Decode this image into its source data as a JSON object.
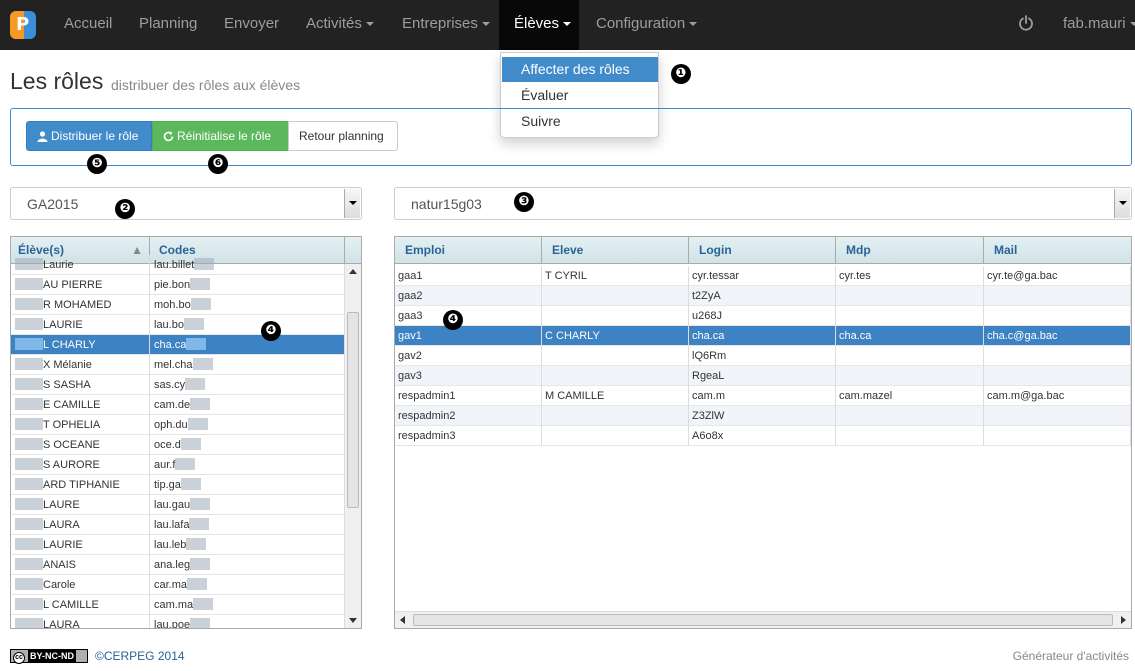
{
  "nav": {
    "items": [
      "Accueil",
      "Planning",
      "Envoyer",
      "Activités",
      "Entreprises",
      "Élèves",
      "Configuration"
    ],
    "user": "fab.mauri"
  },
  "dropdown": {
    "items": [
      "Affecter des rôles",
      "Évaluer",
      "Suivre"
    ]
  },
  "markers": [
    "❶",
    "❷",
    "❸",
    "❹",
    "❹",
    "❺",
    "❻"
  ],
  "header": {
    "title": "Les rôles",
    "subtitle": "distribuer des rôles aux élèves"
  },
  "toolbar": {
    "distribute": "Distribuer le rôle",
    "reset": "Réinitialise le rôle",
    "back": "Retour planning"
  },
  "selects": {
    "group": "GA2015",
    "activity": "natur15g03"
  },
  "students": {
    "headers": [
      "Élève(s)",
      "Codes"
    ],
    "rows": [
      [
        "Laurie",
        "lau.billet"
      ],
      [
        "AU PIERRE",
        "pie.bon"
      ],
      [
        "R MOHAMED",
        "moh.bo"
      ],
      [
        "LAURIE",
        "lau.bo"
      ],
      [
        "L CHARLY",
        "cha.ca"
      ],
      [
        "X Mélanie",
        "mel.cha"
      ],
      [
        "S SASHA",
        "sas.cy"
      ],
      [
        "E CAMILLE",
        "cam.de"
      ],
      [
        "T OPHELIA",
        "oph.du"
      ],
      [
        "S OCEANE",
        "oce.d"
      ],
      [
        "S AURORE",
        "aur.f"
      ],
      [
        "ARD TIPHANIE",
        "tip.ga"
      ],
      [
        "LAURE",
        "lau.gau"
      ],
      [
        "LAURA",
        "lau.lafa"
      ],
      [
        "LAURIE",
        "lau.leb"
      ],
      [
        "ANAIS",
        "ana.leg"
      ],
      [
        "Carole",
        "car.ma"
      ],
      [
        "L CAMILLE",
        "cam.ma"
      ],
      [
        "LAURA",
        "lau.poe"
      ]
    ]
  },
  "roles": {
    "headers": [
      "Emploi",
      "Eleve",
      "Login",
      "Mdp",
      "Mail"
    ],
    "rows": [
      [
        "gaa1",
        "T CYRIL",
        "cyr.tessar",
        "cyr.tes",
        "cyr.te@ga.bac"
      ],
      [
        "gaa2",
        "",
        "t2ZyA",
        "",
        ""
      ],
      [
        "gaa3",
        "",
        "u268J",
        "",
        ""
      ],
      [
        "gav1",
        "C CHARLY",
        "cha.ca",
        "cha.ca",
        "cha.c@ga.bac"
      ],
      [
        "gav2",
        "",
        "lQ6Rm",
        "",
        ""
      ],
      [
        "gav3",
        "",
        "RgeaL",
        "",
        ""
      ],
      [
        "respadmin1",
        "M CAMILLE",
        "cam.m",
        "cam.mazel",
        "cam.m@ga.bac"
      ],
      [
        "respadmin2",
        "",
        "Z3ZlW",
        "",
        ""
      ],
      [
        "respadmin3",
        "",
        "A6o8x",
        "",
        ""
      ]
    ]
  },
  "footer": {
    "license": "BY-NC-ND",
    "cc": "cc",
    "copyright": "©CERPEG 2014",
    "right": "Générateur d'activités"
  }
}
